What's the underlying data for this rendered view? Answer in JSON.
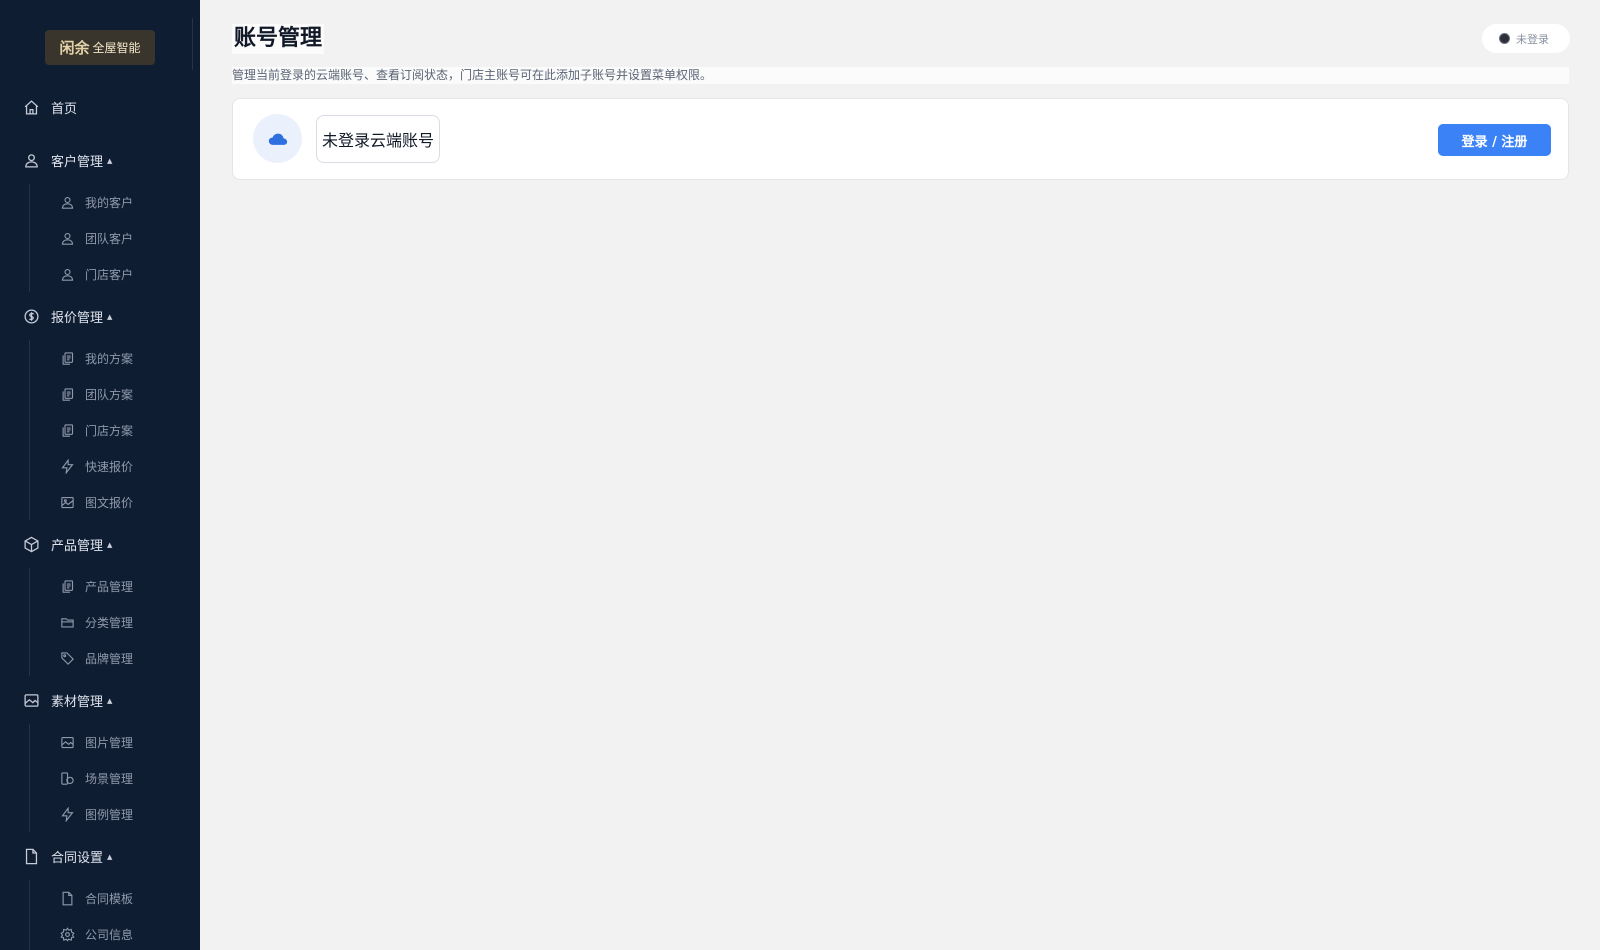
{
  "app": {
    "logo": {
      "mark": "闲余",
      "text": "全屋智能"
    }
  },
  "sidebar": {
    "home": {
      "label": "首页"
    },
    "groups": [
      {
        "label": "客户管理",
        "items": [
          {
            "label": "我的客户"
          },
          {
            "label": "团队客户"
          },
          {
            "label": "门店客户"
          }
        ]
      },
      {
        "label": "报价管理",
        "items": [
          {
            "label": "我的方案"
          },
          {
            "label": "团队方案"
          },
          {
            "label": "门店方案"
          },
          {
            "label": "快速报价"
          },
          {
            "label": "图文报价"
          }
        ]
      },
      {
        "label": "产品管理",
        "items": [
          {
            "label": "产品管理"
          },
          {
            "label": "分类管理"
          },
          {
            "label": "品牌管理"
          }
        ]
      },
      {
        "label": "素材管理",
        "items": [
          {
            "label": "图片管理"
          },
          {
            "label": "场景管理"
          },
          {
            "label": "图例管理"
          }
        ]
      },
      {
        "label": "合同设置",
        "items": [
          {
            "label": "合同模板"
          },
          {
            "label": "公司信息"
          }
        ]
      }
    ],
    "caret": "▲"
  },
  "main": {
    "title": "账号管理",
    "description": "管理当前登录的云端账号、查看订阅状态，门店主账号可在此添加子账号并设置菜单权限。",
    "status": {
      "label": "未登录"
    },
    "account_card": {
      "account_label": "未登录云端账号",
      "login_button": "登录 / 注册"
    }
  },
  "colors": {
    "sidebar_bg": "#0f1d33",
    "accent": "#3b82f6",
    "page_bg": "#f2f2f2"
  }
}
